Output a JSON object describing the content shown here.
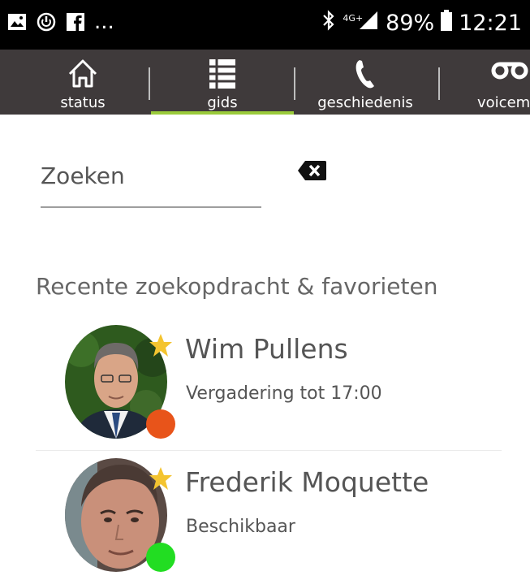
{
  "status_bar": {
    "left_icons": [
      "image-icon",
      "power-icon",
      "facebook-icon"
    ],
    "more": "...",
    "bluetooth_icon": "bluetooth-icon",
    "network": "4G+",
    "signal_icon": "signal-icon",
    "battery": "89%",
    "battery_icon": "battery-icon",
    "time": "12:21"
  },
  "tabs": [
    {
      "label": "status",
      "icon": "home-icon"
    },
    {
      "label": "gids",
      "icon": "list-icon",
      "active": true
    },
    {
      "label": "geschiedenis",
      "icon": "phone-icon"
    },
    {
      "label": "voicem",
      "icon": "voicemail-icon"
    }
  ],
  "search": {
    "placeholder": "Zoeken",
    "clear_icon": "backspace-icon"
  },
  "section_title": "Recente zoekopdracht & favorieten",
  "contacts": [
    {
      "name": "Wim Pullens",
      "status": "Vergadering tot 17:00",
      "favorite": true,
      "presence_color": "#e8541a"
    },
    {
      "name": "Frederik Moquette",
      "status": "Beschikbaar",
      "favorite": true,
      "presence_color": "#22dd22"
    }
  ],
  "colors": {
    "tab_bar": "#3f3a3b",
    "active_tab_underline": "#9acb3b",
    "star": "#f4c430"
  }
}
